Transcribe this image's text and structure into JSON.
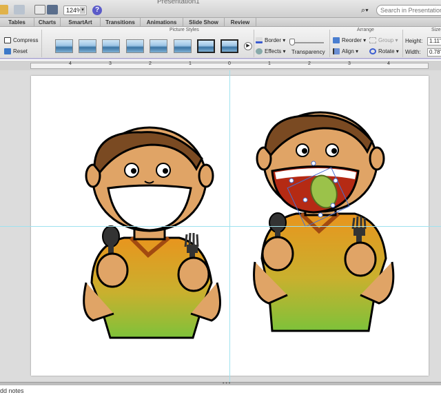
{
  "window": {
    "title": "Presentation1"
  },
  "toolbar": {
    "zoom": "124%",
    "help": "?",
    "search_placeholder": "Search in Presentation"
  },
  "tabs": [
    {
      "label": "Tables"
    },
    {
      "label": "Charts"
    },
    {
      "label": "SmartArt"
    },
    {
      "label": "Transitions"
    },
    {
      "label": "Animations"
    },
    {
      "label": "Slide Show"
    },
    {
      "label": "Review"
    }
  ],
  "ribbon": {
    "adjust": {
      "compress": "Compress",
      "reset": "Reset"
    },
    "picture_styles": {
      "label": "Picture Styles"
    },
    "format": {
      "border": "Border",
      "effects": "Effects",
      "transparency": "Transparency"
    },
    "arrange": {
      "label": "Arrange",
      "reorder": "Reorder",
      "group": "Group",
      "align": "Align",
      "rotate": "Rotate"
    },
    "size": {
      "label": "Size",
      "height_label": "Height:",
      "height_value": "1.11\"",
      "width_label": "Width:",
      "width_value": "0.78\""
    }
  },
  "ruler": {
    "labels": [
      "4",
      "3",
      "2",
      "1",
      "0",
      "1",
      "2",
      "3",
      "4"
    ]
  },
  "notes": {
    "placeholder": "Click to add notes",
    "visible_text": "dd notes"
  },
  "colors": {
    "skin": "#e0a466",
    "hair": "#7a4a22",
    "shirt_top": "#e8951e",
    "shirt_bottom": "#7ec23a",
    "guide": "#9ee2ef",
    "accent": "#5b5bc9"
  },
  "icons": [
    "search-icon",
    "help-icon",
    "compress-icon",
    "reset-icon",
    "border-icon",
    "effects-icon",
    "reorder-icon",
    "align-icon",
    "rotate-icon",
    "group-icon"
  ]
}
